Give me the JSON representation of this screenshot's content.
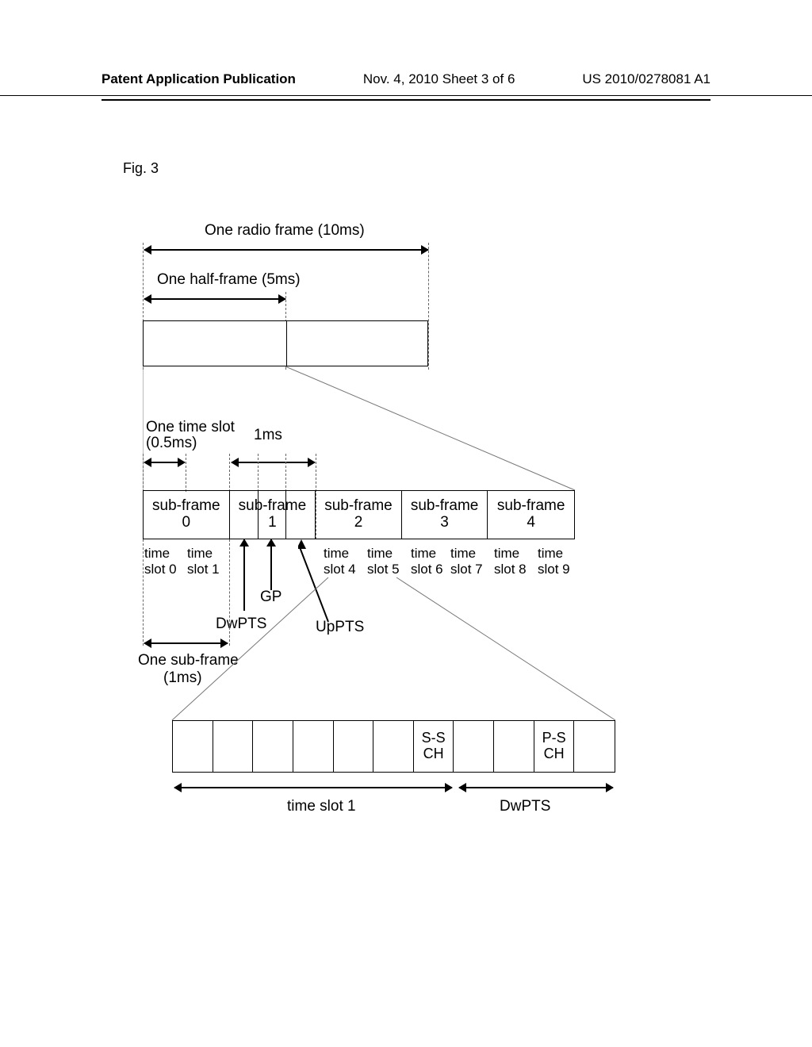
{
  "header": {
    "left": "Patent Application Publication",
    "center": "Nov. 4, 2010  Sheet 3 of 6",
    "right": "US 2010/0278081 A1"
  },
  "figure_label": "Fig. 3",
  "labels": {
    "radio_frame": "One radio frame (10ms)",
    "half_frame": "One half-frame (5ms)",
    "one_time_slot": "One time slot",
    "one_time_slot_dur": "(0.5ms)",
    "one_ms": "1ms",
    "subframe0": "sub-frame\n0",
    "subframe1": "sub-frame\n1",
    "subframe2": "sub-frame\n2",
    "subframe3": "sub-frame\n3",
    "subframe4": "sub-frame\n4",
    "timeslot0": "time\nslot 0",
    "timeslot1": "time\nslot 1",
    "ts4": "time\nslot 4",
    "ts5": "time\nslot 5",
    "ts6": "time\nslot 6",
    "ts7": "time\nslot 7",
    "ts8": "time\nslot 8",
    "ts9": "time\nslot 9",
    "dwpts": "DwPTS",
    "gp": "GP",
    "uppts": "UpPTS",
    "one_subframe": "One sub-frame",
    "one_subframe_dur": "(1ms)",
    "ssch": "S-S\nCH",
    "psch": "P-S\nCH",
    "bottom_ts1": "time slot 1",
    "bottom_dwpts": "DwPTS"
  },
  "chart_data": {
    "type": "diagram",
    "title": "TDD radio frame structure",
    "radio_frame_ms": 10,
    "half_frame_ms": 5,
    "time_slot_ms": 0.5,
    "subframe_ms": 1,
    "subframes_per_halfframe": [
      "sub-frame 0",
      "sub-frame 1",
      "sub-frame 2",
      "sub-frame 3",
      "sub-frame 4"
    ],
    "time_slots": [
      "time slot 0",
      "time slot 1",
      "time slot 4",
      "time slot 5",
      "time slot 6",
      "time slot 7",
      "time slot 8",
      "time slot 9"
    ],
    "special_subframe_parts": [
      "DwPTS",
      "GP",
      "UpPTS"
    ],
    "bottom_detail": {
      "segments": [
        "time slot 1",
        "DwPTS"
      ],
      "sync_channels": [
        {
          "name": "S-SCH",
          "location": "last symbol of time slot 1",
          "col_index": 6
        },
        {
          "name": "P-SCH",
          "location": "third symbol of DwPTS",
          "col_index": 9
        }
      ],
      "symbol_columns": 11
    }
  }
}
